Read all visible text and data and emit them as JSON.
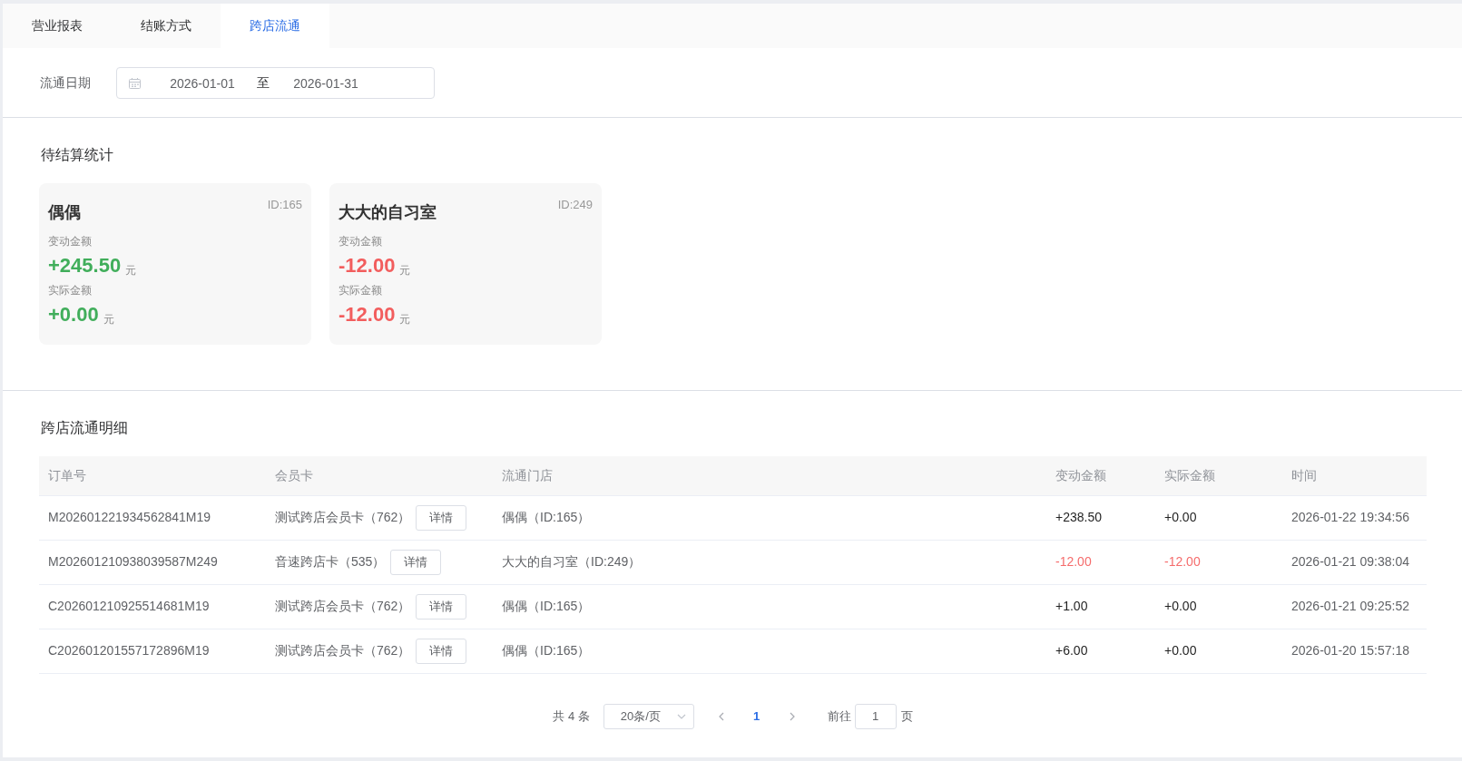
{
  "tabs": [
    {
      "label": "营业报表",
      "selected": false
    },
    {
      "label": "结账方式",
      "selected": false
    },
    {
      "label": "跨店流通",
      "selected": true
    }
  ],
  "filter": {
    "label": "流通日期",
    "start_date": "2026-01-01",
    "separator": "至",
    "end_date": "2026-01-31"
  },
  "pending_summary": {
    "title": "待结算统计",
    "cards": [
      {
        "name": "偶偶",
        "id": "ID:165",
        "change_label": "变动金额",
        "change_amount": "+245.50",
        "change_unit": "元",
        "actual_label": "实际金额",
        "actual_amount": "+0.00",
        "actual_unit": "元",
        "color": "#41ae5b"
      },
      {
        "name": "大大的自习室",
        "id": "ID:249",
        "change_label": "变动金额",
        "change_amount": "-12.00",
        "change_unit": "元",
        "actual_label": "实际金额",
        "actual_amount": "-12.00",
        "actual_unit": "元",
        "color": "#f25d5d"
      }
    ]
  },
  "details": {
    "title": "跨店流通明细",
    "table": {
      "columns": [
        "订单号",
        "会员卡",
        "流通门店",
        "变动金额",
        "实际金额",
        "时间"
      ],
      "rows": [
        {
          "order_no": "M202601221934562841M19",
          "member_card": "测试跨店会员卡（762）",
          "detail_button": "详情",
          "store": "偶偶（ID:165）",
          "change_amount": "+238.50",
          "actual_amount": "+0.00",
          "time": "2026-01-22 19:34:56",
          "color": "#1f1f1f"
        },
        {
          "order_no": "M202601210938039587M249",
          "member_card": "音速跨店卡（535）",
          "detail_button": "详情",
          "store": "大大的自习室（ID:249）",
          "change_amount": "-12.00",
          "actual_amount": "-12.00",
          "time": "2026-01-21 09:38:04",
          "color": "#f56c6c"
        },
        {
          "order_no": "C202601210925514681M19",
          "member_card": "测试跨店会员卡（762）",
          "detail_button": "详情",
          "store": "偶偶（ID:165）",
          "change_amount": "+1.00",
          "actual_amount": "+0.00",
          "time": "2026-01-21 09:25:52",
          "color": "#1f1f1f"
        },
        {
          "order_no": "C202601201557172896M19",
          "member_card": "测试跨店会员卡（762）",
          "detail_button": "详情",
          "store": "偶偶（ID:165）",
          "change_amount": "+6.00",
          "actual_amount": "+0.00",
          "time": "2026-01-20 15:57:18",
          "color": "#1f1f1f"
        }
      ]
    }
  },
  "pagination": {
    "total": "共 4 条",
    "page_size": "20条/页",
    "pages": [
      {
        "label": "1",
        "selected": true
      }
    ],
    "goto_label": "前往",
    "goto_value": "1",
    "goto_suffix": "页"
  }
}
